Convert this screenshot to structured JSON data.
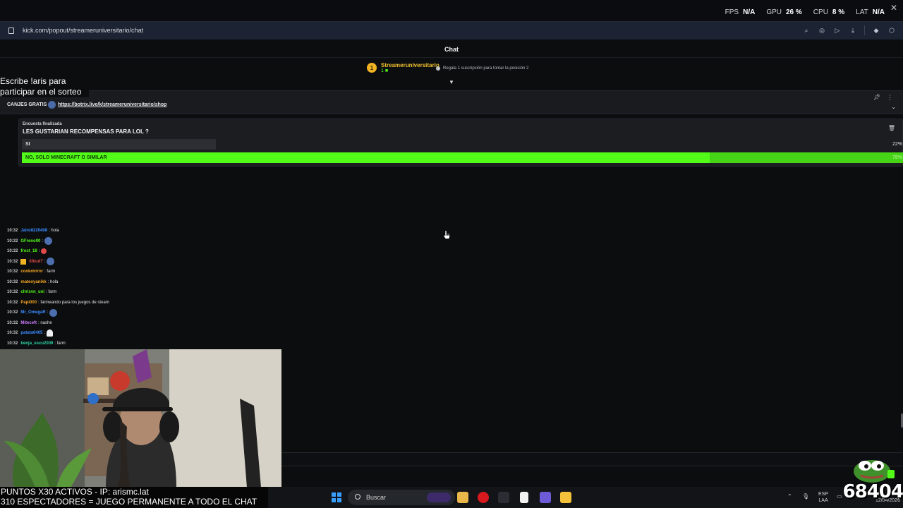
{
  "perf": {
    "fps_label": "FPS",
    "fps_value": "N/A",
    "gpu_label": "GPU",
    "gpu_value": "26 %",
    "cpu_label": "CPU",
    "cpu_value": "8 %",
    "lat_label": "LAT",
    "lat_value": "N/A"
  },
  "browser": {
    "url": "kick.com/popout/streameruniversitario/chat"
  },
  "chat": {
    "title": "Chat",
    "top_sub": {
      "rank": "1",
      "name": "Streameruniversitario",
      "count": "1"
    },
    "gift_hint": "Regala 1 suscripción para tomar la posición 2",
    "pinned": {
      "label": "CANJES GRATIS",
      "link": "https://botrix.live/k/streameruniversitario/shop"
    },
    "poll": {
      "state": "Encuesta finalizada",
      "question": "LES GUSTARIAN RECOMPENSAS PARA LOL ?",
      "options": [
        {
          "label": "SI",
          "percent": "22%",
          "fraction": 0.22
        },
        {
          "label": "NO, SOLO MINECRAFT O SIMILAR",
          "percent": "78%",
          "fraction": 0.78
        }
      ]
    },
    "messages": [
      {
        "time": "10:32",
        "user": "Jairo8220408",
        "user_color": "#3d8bff",
        "text": ": hola",
        "emote": ""
      },
      {
        "time": "10:32",
        "user": "GFreno00",
        "user_color": "#53fc18",
        "text": ":",
        "emote": "avatar"
      },
      {
        "time": "10:32",
        "user": "frost_18",
        "user_color": "#53fc18",
        "text": ":",
        "emote": "red"
      },
      {
        "time": "10:32",
        "user": "lilbud7",
        "user_color": "#e14a4a",
        "text": ":",
        "emote": "avatar",
        "badge": true
      },
      {
        "time": "10:32",
        "user": "cookmirror",
        "user_color": "#f5a623",
        "text": ": farm",
        "emote": ""
      },
      {
        "time": "10:32",
        "user": "mateoyanikk",
        "user_color": "#f5a623",
        "text": ": hola",
        "emote": ""
      },
      {
        "time": "10:32",
        "user": "chrisvn_uni",
        "user_color": "#53fc18",
        "text": ": farm",
        "emote": ""
      },
      {
        "time": "10:32",
        "user": "Papi000",
        "user_color": "#f5a623",
        "text": ": farmeando para los juegos de steam",
        "emote": ""
      },
      {
        "time": "10:32",
        "user": "Mr_OmegaR",
        "user_color": "#3d8bff",
        "text": ":",
        "emote": "avatar"
      },
      {
        "time": "10:32",
        "user": "Miteceft",
        "user_color": "#c77dff",
        "text": ": nashe",
        "emote": ""
      },
      {
        "time": "10:32",
        "user": "patata0405",
        "user_color": "#3d8bff",
        "text": ":",
        "emote": "ghost"
      },
      {
        "time": "10:32",
        "user": "benja_escu2009",
        "user_color": "#2fd3a3",
        "text": ": farm",
        "emote": ""
      }
    ]
  },
  "overlays": {
    "top_text": "Escribe !aris para participar en el sorteo",
    "bottom_line1": "PUNTOS X30 ACTIVOS - IP: arismc.lat",
    "bottom_line2": "310 ESPECTADORES = JUEGO PERMANENTE A TODO EL CHAT",
    "counter": "68404"
  },
  "taskbar": {
    "search_placeholder": "Buscar",
    "lang_line1": "ESP",
    "lang_line2": "LAA",
    "date": "12/04/2026"
  },
  "colors": {
    "kick_green": "#53fc18",
    "gold": "#f0b323"
  }
}
